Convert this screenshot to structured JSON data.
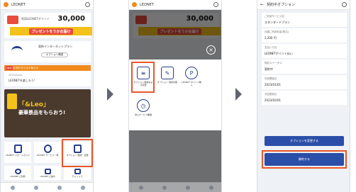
{
  "phone1": {
    "title": "LEONET",
    "points_label": "利用LEONETポイント",
    "points_value": "30,000",
    "promo_text": "プレゼントをうかお届け",
    "net_title": "契約インターネットプラン",
    "net_button": "オプション確認",
    "coupon_bar": "LEONETからのお知らせ",
    "coupon_new": "NEW",
    "coupon_line1": "2023/xx/xx",
    "coupon_line2": "LEONETを楽しもう!",
    "banner_title": "「&Leo」",
    "banner_sub": "豪華景品をもらおう!",
    "grid": [
      {
        "label": "LEONET スタートガイド"
      },
      {
        "label": "LEONET サービス一覧"
      },
      {
        "label": "オプション 確認・変更"
      },
      {
        "label": "LEONETご利用"
      },
      {
        "label": "LEONETご案内"
      },
      {
        "label": "チャットで"
      }
    ],
    "tabs": [
      "ホーム",
      "LEONET",
      "お問合せ",
      "設定"
    ]
  },
  "phone2": {
    "title": "LEONET",
    "sheet_items": [
      {
        "label": "オプション確認および変更",
        "glyph": "≡"
      },
      {
        "label": "オプション 契約内容",
        "glyph": "✎"
      },
      {
        "label": "LEONET ポイント購入",
        "glyph": "P"
      },
      {
        "label": "導入サービス履歴",
        "glyph": "◷"
      }
    ],
    "close_glyph": "×"
  },
  "phone3": {
    "title": "契約中オプション",
    "fields": [
      {
        "key": "ご利用サービス名",
        "value": "スタンダードプラン"
      },
      {
        "key": "月額ご利用料金(税込)",
        "value": "2,200 円"
      },
      {
        "key": "支払い方法",
        "value": "LEONETポイント払い"
      },
      {
        "key": "契約ステータス",
        "value": "契約中"
      },
      {
        "key": "利用開始日",
        "value": "2023/01/01"
      },
      {
        "key": "次回更新日",
        "value": "2023/02/01"
      }
    ],
    "secondary_button": "オプションを変更する",
    "primary_button": "解約する"
  },
  "colors": {
    "highlight": "#e8572a",
    "brand_blue": "#2b4fa8",
    "accent_orange": "#f08a1c"
  }
}
